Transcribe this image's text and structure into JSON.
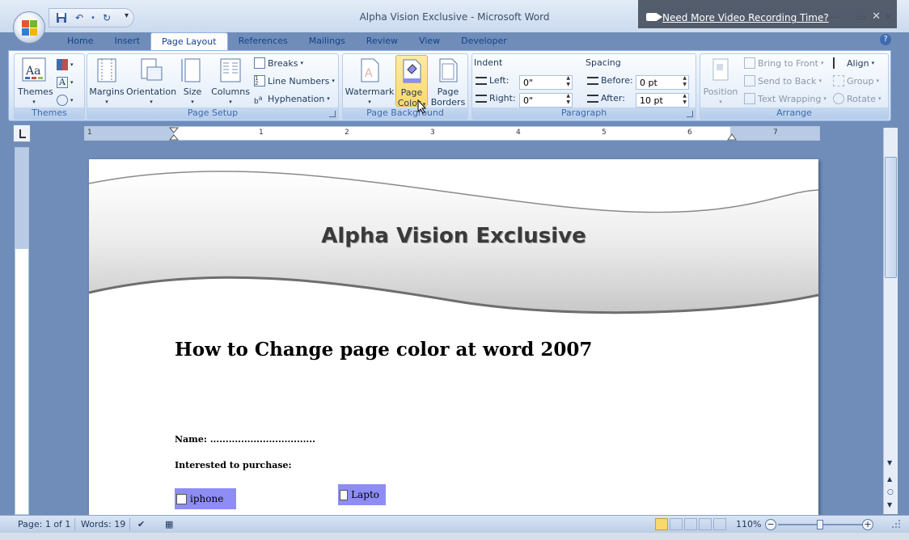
{
  "window": {
    "title": "Alpha Vision Exclusive - Microsoft Word"
  },
  "overlay": {
    "link_text": "Need More Video Recording Time?"
  },
  "tabs": [
    {
      "label": "Home"
    },
    {
      "label": "Insert"
    },
    {
      "label": "Page Layout",
      "active": true
    },
    {
      "label": "References"
    },
    {
      "label": "Mailings"
    },
    {
      "label": "Review"
    },
    {
      "label": "View"
    },
    {
      "label": "Developer"
    }
  ],
  "ribbon": {
    "themes": {
      "group_label": "Themes",
      "themes_label": "Themes"
    },
    "page_setup": {
      "group_label": "Page Setup",
      "margins": "Margins",
      "orientation": "Orientation",
      "size": "Size",
      "columns": "Columns",
      "breaks": "Breaks",
      "line_numbers": "Line Numbers",
      "hyphenation": "Hyphenation"
    },
    "page_background": {
      "group_label": "Page Background",
      "watermark": "Watermark",
      "page_color_line1": "Page",
      "page_color_line2": "Color",
      "page_borders_line1": "Page",
      "page_borders_line2": "Borders"
    },
    "paragraph": {
      "group_label": "Paragraph",
      "indent_label": "Indent",
      "left_label": "Left:",
      "left_value": "0\"",
      "right_label": "Right:",
      "right_value": "0\"",
      "spacing_label": "Spacing",
      "before_label": "Before:",
      "before_value": "0 pt",
      "after_label": "After:",
      "after_value": "10 pt"
    },
    "arrange": {
      "group_label": "Arrange",
      "position": "Position",
      "bring_to_front": "Bring to Front",
      "send_to_back": "Send to Back",
      "text_wrapping": "Text Wrapping",
      "align": "Align",
      "group": "Group",
      "rotate": "Rotate"
    }
  },
  "ruler": {
    "numbers": [
      "1",
      "1",
      "2",
      "3",
      "4",
      "5",
      "6",
      "7"
    ]
  },
  "document": {
    "banner_title": "Alpha Vision Exclusive",
    "heading": "How to Change page color at word 2007",
    "name_line": "Name: ..................................",
    "interested": "Interested to purchase:",
    "checkboxes": [
      {
        "label": "iphone"
      },
      {
        "label": "Lapto"
      }
    ]
  },
  "statusbar": {
    "page": "Page: 1 of 1",
    "words": "Words: 19",
    "zoom": "110%"
  },
  "colors": {
    "page_color_highlight": "#f9d96b",
    "checkbox_bg": "#8d8df5"
  }
}
